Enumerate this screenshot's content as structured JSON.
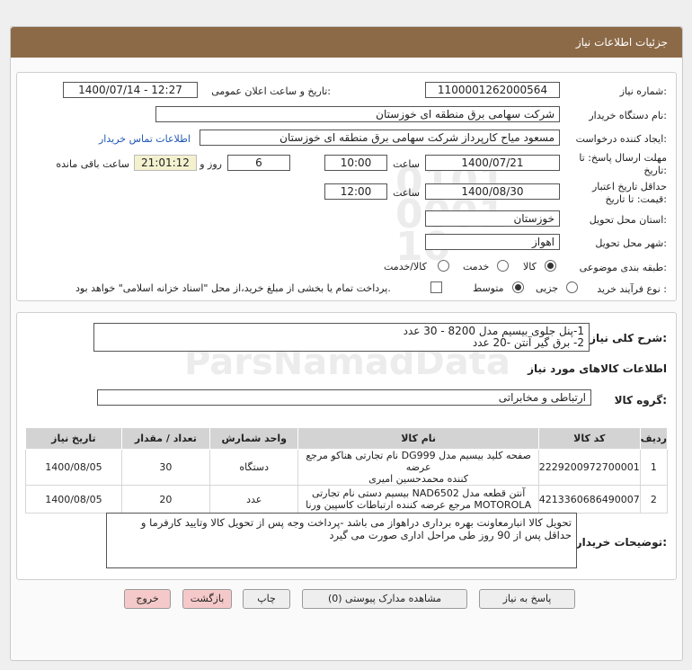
{
  "header": {
    "title": "جزئیات اطلاعات نیاز"
  },
  "form": {
    "need_number": {
      "label": "شماره نیاز:",
      "value": "1100001262000564"
    },
    "announce": {
      "label": "تاریخ و ساعت اعلان عمومی:",
      "value": "1400/07/14 - 12:27"
    },
    "buyer": {
      "label": "نام دستگاه خریدار:",
      "value": "شرکت سهامی برق منطقه ای خوزستان"
    },
    "creator": {
      "label": "ایجاد کننده درخواست:",
      "value": "مسعود میاح کارپرداز شرکت سهامی برق منطقه ای خوزستان",
      "contact_link": "اطلاعات تماس خریدار"
    },
    "reply_deadline": {
      "label1": "مهلت ارسال پاسخ: تا",
      "label2": "تاریخ:",
      "date": "1400/07/21",
      "time_label": "ساعت",
      "time": "10:00",
      "days": "6",
      "days_label": "روز و",
      "remaining": "21:01:12",
      "remaining_label": "ساعت باقی مانده"
    },
    "validity": {
      "label1": "حداقل تاریخ اعتبار",
      "label2": "قیمت: تا تاریخ:",
      "date": "1400/08/30",
      "time_label": "ساعت",
      "time": "12:00"
    },
    "province": {
      "label": "استان محل تحویل:",
      "value": "خوزستان"
    },
    "city": {
      "label": "شهر محل تحویل:",
      "value": "اهواز"
    },
    "category": {
      "label": "طبقه بندی موضوعی:",
      "options": [
        "کالا",
        "خدمت",
        "کالا/خدمت"
      ]
    },
    "process": {
      "label": "نوع فرآیند خرید :",
      "options": [
        "جزیی",
        "متوسط"
      ],
      "note": "پرداخت تمام یا بخشی از مبلغ خرید،از محل \"اسناد خزانه اسلامی\" خواهد بود."
    }
  },
  "description": {
    "label": "شرح کلی نیاز:",
    "lines": [
      "1-پنل جلوی بیسیم مدل 8200 - 30 عدد",
      "2- برق گیر آنتن -20 عدد"
    ]
  },
  "goods": {
    "section_title": "اطلاعات کالاهای مورد نیاز",
    "group_label": "گروه کالا:",
    "group_value": "ارتباطی و مخابراتی",
    "columns": [
      "ردیف",
      "کد کالا",
      "نام کالا",
      "واحد شمارش",
      "تعداد / مقدار",
      "تاریخ نیاز"
    ],
    "rows": [
      {
        "row": "1",
        "code": "2229200972700001",
        "name_lines": [
          "صفحه کلید بیسیم مدل DG999 نام تجارتی هناکو مرجع عرضه",
          "کننده محمدحسین امیری"
        ],
        "unit": "دستگاه",
        "qty": "30",
        "date": "1400/08/05"
      },
      {
        "row": "2",
        "code": "4213360686490007",
        "name_lines": [
          "آنتن قطعه مدل NAD6502 بیسیم دستی نام تجارتی",
          "MOTOROLA مرجع عرضه کننده ارتباطات کاسپین ورنا"
        ],
        "unit": "عدد",
        "qty": "20",
        "date": "1400/08/05"
      }
    ]
  },
  "buyer_notes": {
    "label": "توضیحات خریدار:",
    "lines": [
      "تحویل کالا انبارمعاونت بهره برداری دراهواز می باشد -پرداخت وجه پس از تحویل کالا وتایید کارفرما و",
      "حداقل پس از 90 روز طی مراحل اداری صورت می گیرد"
    ]
  },
  "buttons": {
    "reply": "پاسخ به نیاز",
    "attachments": "مشاهده مدارک پیوستی (0)",
    "print": "چاپ",
    "back": "بازگشت",
    "exit": "خروج"
  }
}
